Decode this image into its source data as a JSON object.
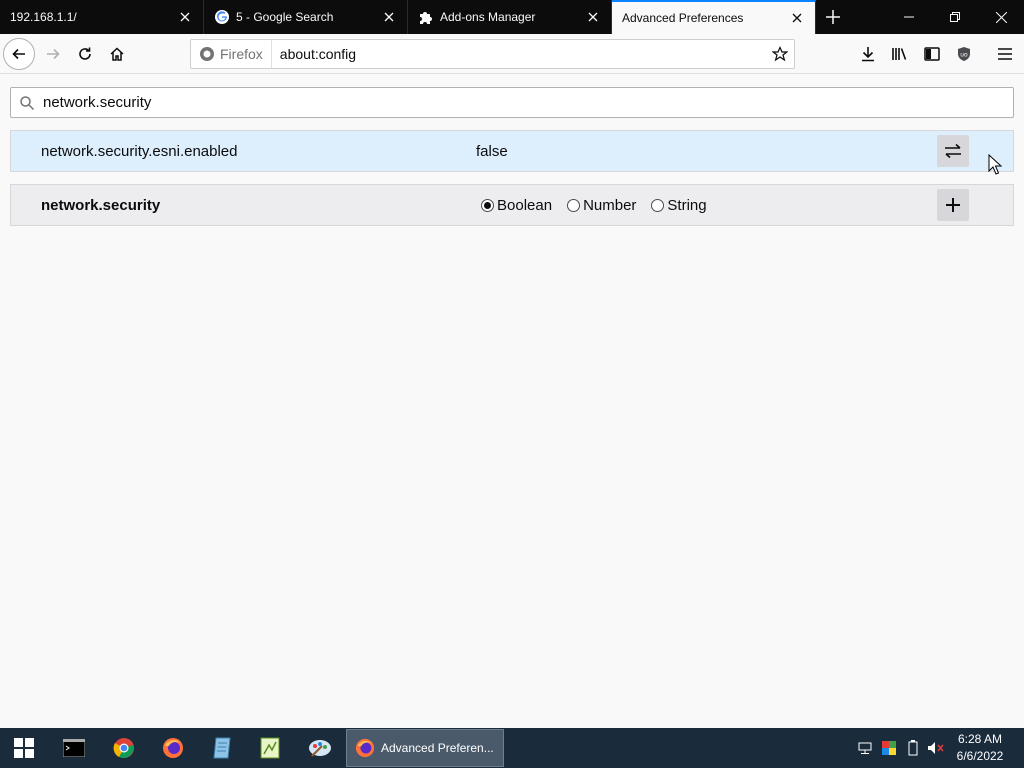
{
  "tabs": [
    {
      "title": "192.168.1.1/",
      "icon": "none"
    },
    {
      "title": "5 - Google Search",
      "icon": "google-icon"
    },
    {
      "title": "Add-ons Manager",
      "icon": "puzzle-icon"
    },
    {
      "title": "Advanced Preferences",
      "icon": "none",
      "active": true
    }
  ],
  "navbar": {
    "identity_label": "Firefox",
    "url": "about:config"
  },
  "search": {
    "value": "network.security"
  },
  "existing_pref": {
    "name": "network.security.esni.enabled",
    "value": "false"
  },
  "new_pref": {
    "name": "network.security",
    "types": [
      "Boolean",
      "Number",
      "String"
    ],
    "selected_type": "Boolean"
  },
  "taskbar": {
    "window_label": "Advanced Preferen...",
    "time": "6:28 AM",
    "date": "6/6/2022"
  },
  "colors": {
    "accent": "#0a84ff",
    "selected_row": "#ddeefc",
    "taskbar": "#1a2b3c"
  }
}
